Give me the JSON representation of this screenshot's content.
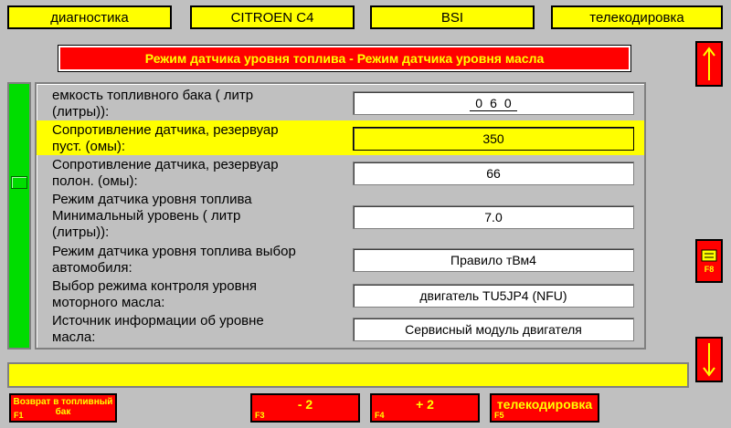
{
  "tabs": [
    "диагностика",
    "CITROEN C4",
    "BSI",
    "телекодировка"
  ],
  "title": "Режим датчика уровня топлива - Режим датчика уровня масла",
  "side": {
    "f8_code": "F8"
  },
  "rows": [
    {
      "label": "емкость топливного бака ( литр\n(литры)):",
      "digits": [
        "0",
        "6",
        "0"
      ]
    },
    {
      "label": "Сопротивление датчика, резервуар\nпуст. (омы):",
      "value": "350"
    },
    {
      "label": "Сопротивление датчика, резервуар\nполон. (омы):",
      "value": "66"
    },
    {
      "label": "Режим датчика уровня топлива\nМинимальный уровень ( литр\n(литры)):",
      "value": "7.0"
    },
    {
      "label": "Режим датчика уровня топлива выбор\nавтомобиля:",
      "value": "Правило тВм4"
    },
    {
      "label": "Выбор режима контроля уровня\nмоторного масла:",
      "value": "двигатель TU5JP4 (NFU)"
    },
    {
      "label": "Источник информации об уровне\nмасла:",
      "value": "Сервисный модуль двигателя"
    }
  ],
  "fkeys": [
    {
      "label": "Возврат в топливный бак",
      "code": "F1"
    },
    {
      "label": "- 2",
      "code": "F3"
    },
    {
      "label": "+ 2",
      "code": "F4"
    },
    {
      "label": "телекодировка",
      "code": "F5"
    }
  ],
  "colors": {
    "bg": "#c0c0c0",
    "yellow": "#ffff00",
    "red": "#ff0000",
    "green": "#00dd00"
  }
}
